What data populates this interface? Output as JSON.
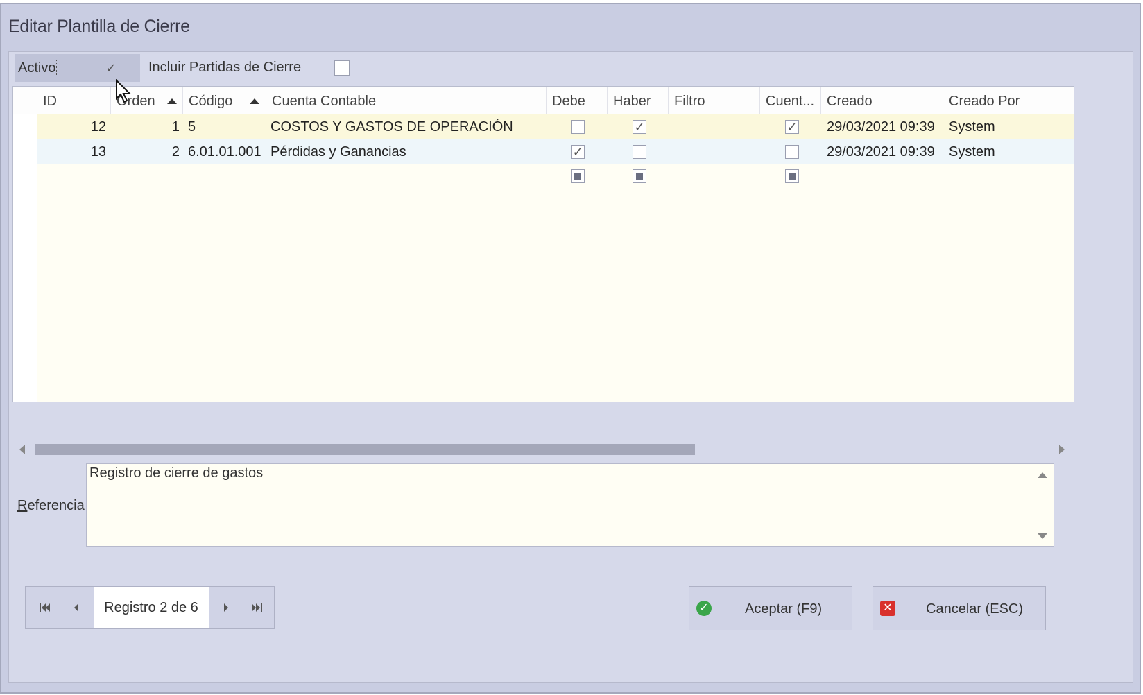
{
  "window": {
    "title": "Editar Plantilla de Cierre"
  },
  "options": {
    "activo": {
      "label": "Activo",
      "checked": true
    },
    "incluir": {
      "label": "Incluir Partidas de Cierre",
      "checked": false
    }
  },
  "grid": {
    "columns": [
      "ID",
      "Orden",
      "Código",
      "Cuenta Contable",
      "Debe",
      "Haber",
      "Filtro",
      "Cuent...",
      "Creado",
      "Creado Por"
    ],
    "rows": [
      {
        "id": "12",
        "orden": "1",
        "codigo": "5",
        "cuenta": "COSTOS Y GASTOS DE OPERACIÓN",
        "debe": false,
        "haber": true,
        "cuent": true,
        "creado": "29/03/2021 09:39",
        "creado_por": "System"
      },
      {
        "id": "13",
        "orden": "2",
        "codigo": "6.01.01.001",
        "cuenta": "Pérdidas y Ganancias",
        "debe": true,
        "haber": false,
        "cuent": false,
        "creado": "29/03/2021 09:39",
        "creado_por": "System"
      }
    ]
  },
  "referencia": {
    "label": "Referencia",
    "value": "Registro de cierre de gastos"
  },
  "navigator": {
    "text": "Registro 2 de 6"
  },
  "buttons": {
    "accept": "Aceptar (F9)",
    "cancel": "Cancelar (ESC)"
  },
  "colors": {
    "window_bg": "#c9cde2",
    "grid_bg": "#fffef4",
    "accept_icon": "#3aa54a",
    "cancel_icon": "#d9302c"
  }
}
